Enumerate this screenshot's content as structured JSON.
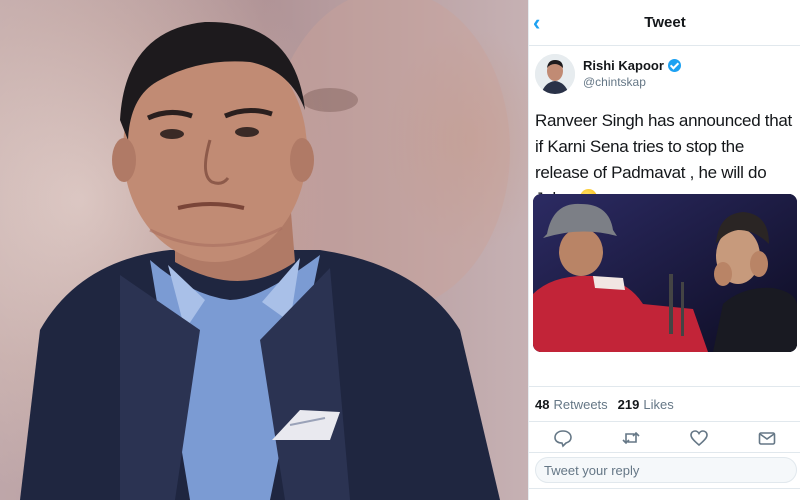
{
  "colors": {
    "twitter_blue": "#1da1f2",
    "text_primary": "#14171a",
    "text_secondary": "#657786",
    "border": "#e1e8ed"
  },
  "photo": {
    "description_icon": "person-portrait"
  },
  "tweet_view": {
    "nav": {
      "back_icon": "chevron-left-icon",
      "title": "Tweet"
    },
    "author": {
      "name": "Rishi Kapoor",
      "handle": "@chintskap",
      "verified_icon": "verified-badge-icon"
    },
    "text": "Ranveer Singh has announced that if Karni Sena tries to stop the release of Padmavat , he will do Johar",
    "emoji_icon": "winking-tongue-emoji",
    "stats": {
      "retweets_count": "48",
      "retweets_label": "Retweets",
      "likes_count": "219",
      "likes_label": "Likes"
    },
    "actions": [
      "reply-icon",
      "retweet-icon",
      "like-icon",
      "share-icon"
    ],
    "reply": {
      "placeholder": "Tweet your reply"
    }
  }
}
